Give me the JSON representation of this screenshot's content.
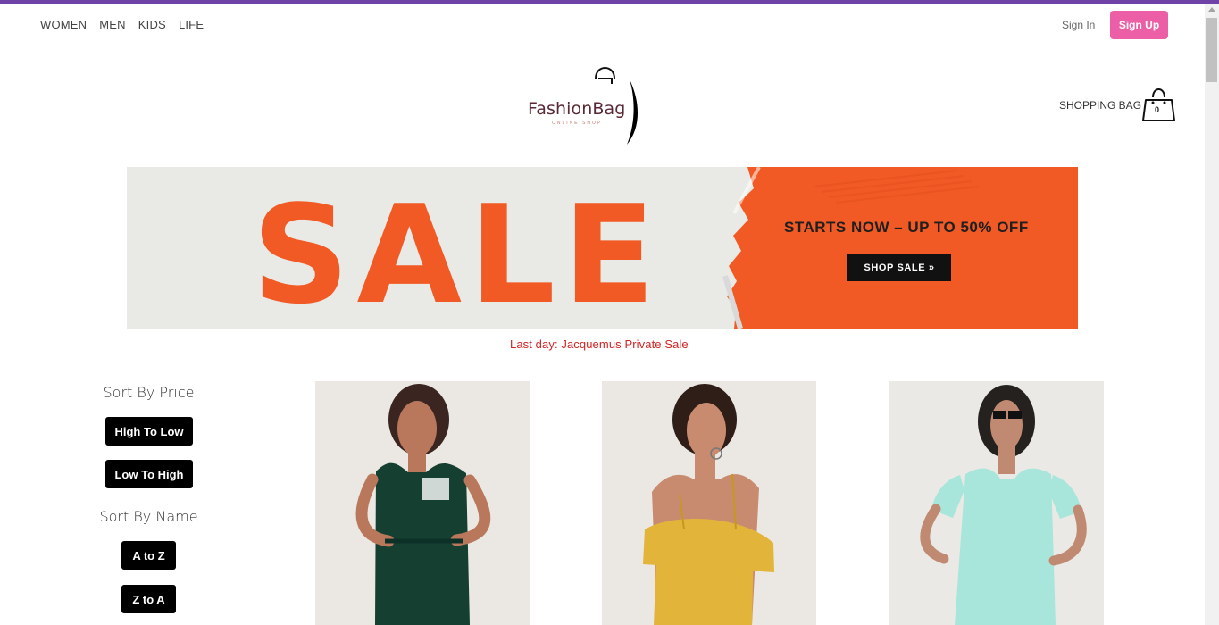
{
  "nav": {
    "links": [
      "WOMEN",
      "MEN",
      "KIDS",
      "LIFE"
    ],
    "sign_in": "Sign In",
    "sign_up": "Sign Up"
  },
  "logo": {
    "name": "FashionBag",
    "tagline": "ONLINE SHOP"
  },
  "bag": {
    "label": "SHOPPING BAG",
    "count": "0"
  },
  "banner": {
    "title": "SALE",
    "heading": "STARTS NOW – UP TO 50% OFF",
    "button": "SHOP SALE »",
    "promo": "Last day: Jacquemus Private Sale"
  },
  "sort": {
    "price_title": "Sort By Price",
    "high_to_low": "High To Low",
    "low_to_high": "Low To High",
    "name_title": "Sort By Name",
    "a_to_z": "A to Z",
    "z_to_a": "Z to A"
  },
  "products": [
    {
      "image": "woman in dark green t-shirt dress"
    },
    {
      "image": "woman in yellow cold-shoulder ruffle top"
    },
    {
      "image": "woman with sunglasses in mint dress"
    }
  ],
  "colors": {
    "accent_bar": "#6f42a8",
    "sign_up": "#ec5fa6",
    "banner_orange": "#f15a24",
    "promo_text": "#d32424",
    "sort_button": "#000000"
  }
}
